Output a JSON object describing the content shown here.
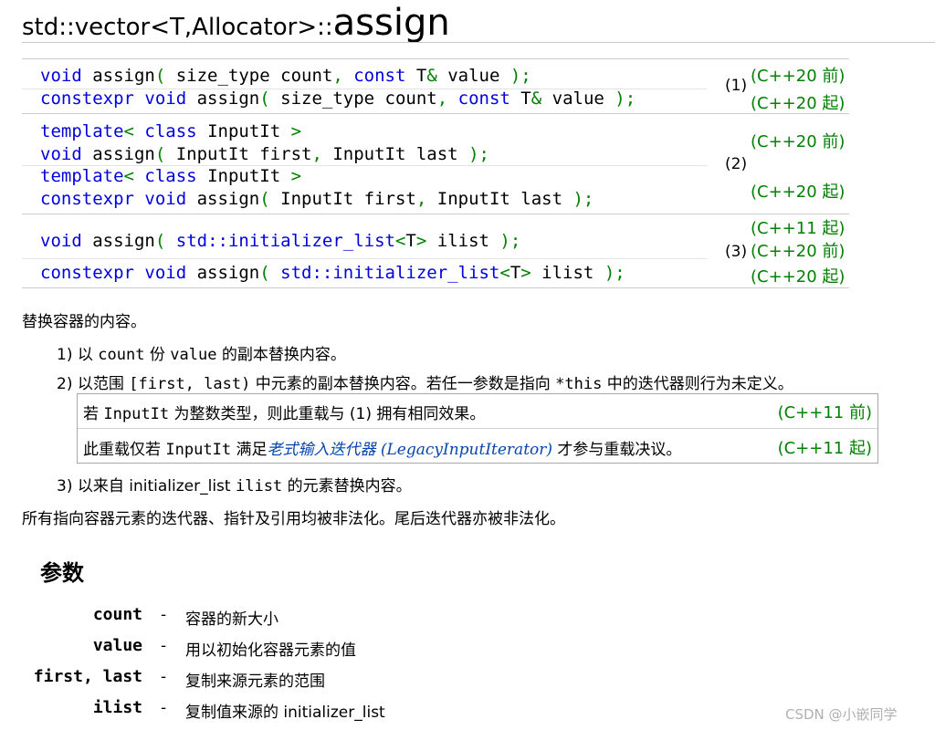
{
  "title": {
    "prefix": "std::vector<T,Allocator>::",
    "name": "assign"
  },
  "overloads": [
    {
      "label": "(1)",
      "variants": [
        {
          "parts": [
            {
              "t": "void",
              "c": "kw"
            },
            {
              "t": " assign"
            },
            {
              "t": "(",
              "c": "pn"
            },
            {
              "t": " size_type count"
            },
            {
              "t": ",",
              "c": "pn"
            },
            {
              "t": " "
            },
            {
              "t": "const",
              "c": "kw"
            },
            {
              "t": " T"
            },
            {
              "t": "&",
              "c": "pn"
            },
            {
              "t": " value "
            },
            {
              "t": ");",
              "c": "pn"
            }
          ],
          "version": "(C++20 前)"
        },
        {
          "parts": [
            {
              "t": "constexpr",
              "c": "kw"
            },
            {
              "t": " "
            },
            {
              "t": "void",
              "c": "kw"
            },
            {
              "t": " assign"
            },
            {
              "t": "(",
              "c": "pn"
            },
            {
              "t": " size_type count"
            },
            {
              "t": ",",
              "c": "pn"
            },
            {
              "t": " "
            },
            {
              "t": "const",
              "c": "kw"
            },
            {
              "t": " T"
            },
            {
              "t": "&",
              "c": "pn"
            },
            {
              "t": " value "
            },
            {
              "t": ");",
              "c": "pn"
            }
          ],
          "version": "(C++20 起)"
        }
      ]
    },
    {
      "label": "(2)",
      "variants": [
        {
          "parts": [
            {
              "t": "template",
              "c": "kw"
            },
            {
              "t": "<",
              "c": "pn"
            },
            {
              "t": " "
            },
            {
              "t": "class",
              "c": "kw"
            },
            {
              "t": " InputIt "
            },
            {
              "t": ">",
              "c": "pn"
            }
          ],
          "parts2": [
            {
              "t": "void",
              "c": "kw"
            },
            {
              "t": " assign"
            },
            {
              "t": "(",
              "c": "pn"
            },
            {
              "t": " InputIt first"
            },
            {
              "t": ",",
              "c": "pn"
            },
            {
              "t": " InputIt last "
            },
            {
              "t": ");",
              "c": "pn"
            }
          ],
          "version": "(C++20 前)"
        },
        {
          "parts": [
            {
              "t": "template",
              "c": "kw"
            },
            {
              "t": "<",
              "c": "pn"
            },
            {
              "t": " "
            },
            {
              "t": "class",
              "c": "kw"
            },
            {
              "t": " InputIt "
            },
            {
              "t": ">",
              "c": "pn"
            }
          ],
          "parts2": [
            {
              "t": "constexpr",
              "c": "kw"
            },
            {
              "t": " "
            },
            {
              "t": "void",
              "c": "kw"
            },
            {
              "t": " assign"
            },
            {
              "t": "(",
              "c": "pn"
            },
            {
              "t": " InputIt first"
            },
            {
              "t": ",",
              "c": "pn"
            },
            {
              "t": " InputIt last "
            },
            {
              "t": ");",
              "c": "pn"
            }
          ],
          "version": "(C++20 起)"
        }
      ]
    },
    {
      "label": "(3)",
      "variants": [
        {
          "parts": [
            {
              "t": "void",
              "c": "kw"
            },
            {
              "t": " assign"
            },
            {
              "t": "(",
              "c": "pn"
            },
            {
              "t": " "
            },
            {
              "t": "std::initializer_list",
              "c": "kw"
            },
            {
              "t": "<",
              "c": "pn"
            },
            {
              "t": "T"
            },
            {
              "t": ">",
              "c": "pn"
            },
            {
              "t": " ilist "
            },
            {
              "t": ");",
              "c": "pn"
            }
          ],
          "versions": [
            "(C++11 起)",
            "(C++20 前)"
          ]
        },
        {
          "parts": [
            {
              "t": "constexpr",
              "c": "kw"
            },
            {
              "t": " "
            },
            {
              "t": "void",
              "c": "kw"
            },
            {
              "t": " assign"
            },
            {
              "t": "(",
              "c": "pn"
            },
            {
              "t": " "
            },
            {
              "t": "std::initializer_list",
              "c": "kw"
            },
            {
              "t": "<",
              "c": "pn"
            },
            {
              "t": "T"
            },
            {
              "t": ">",
              "c": "pn"
            },
            {
              "t": " ilist "
            },
            {
              "t": ");",
              "c": "pn"
            }
          ],
          "version": "(C++20 起)"
        }
      ]
    }
  ],
  "summary": "替换容器的内容。",
  "items": {
    "i1": {
      "num": "1)",
      "a": "以 ",
      "code1": "count",
      "b": " 份 ",
      "code2": "value",
      "c": " 的副本替换内容。"
    },
    "i2": {
      "num": "2)",
      "a": "以范围 ",
      "code1": "[first, last)",
      "b": " 中元素的副本替换内容。若任一参数是指向 ",
      "code2": "*this",
      "c": " 中的迭代器则行为未定义。"
    },
    "i3": {
      "num": "3)",
      "a": "以来自 initializer_list ",
      "code1": "ilist",
      "b": " 的元素替换内容。"
    }
  },
  "notes": [
    {
      "a": "若 ",
      "code": "InputIt",
      "b": " 为整数类型，则此重载与 (1) 拥有相同效果。",
      "version": "(C++11 前)"
    },
    {
      "a": "此重载仅若 ",
      "code": "InputIt",
      "b": " 满足",
      "link": "老式输入迭代器 (LegacyInputIterator)",
      "c": " 才参与重载决议。",
      "version": "(C++11 起)"
    }
  ],
  "invalidation": "所有指向容器元素的迭代器、指针及引用均被非法化。尾后迭代器亦被非法化。",
  "params_heading": "参数",
  "params": [
    {
      "name": "count",
      "dash": "-",
      "desc": "容器的新大小"
    },
    {
      "name": "value",
      "dash": "-",
      "desc": "用以初始化容器元素的值"
    },
    {
      "name": "first, last",
      "dash": "-",
      "desc": "复制来源元素的范围"
    },
    {
      "name": "ilist",
      "dash": "-",
      "desc": "复制值来源的 initializer_list"
    }
  ],
  "watermark": "CSDN @小嵌同学"
}
